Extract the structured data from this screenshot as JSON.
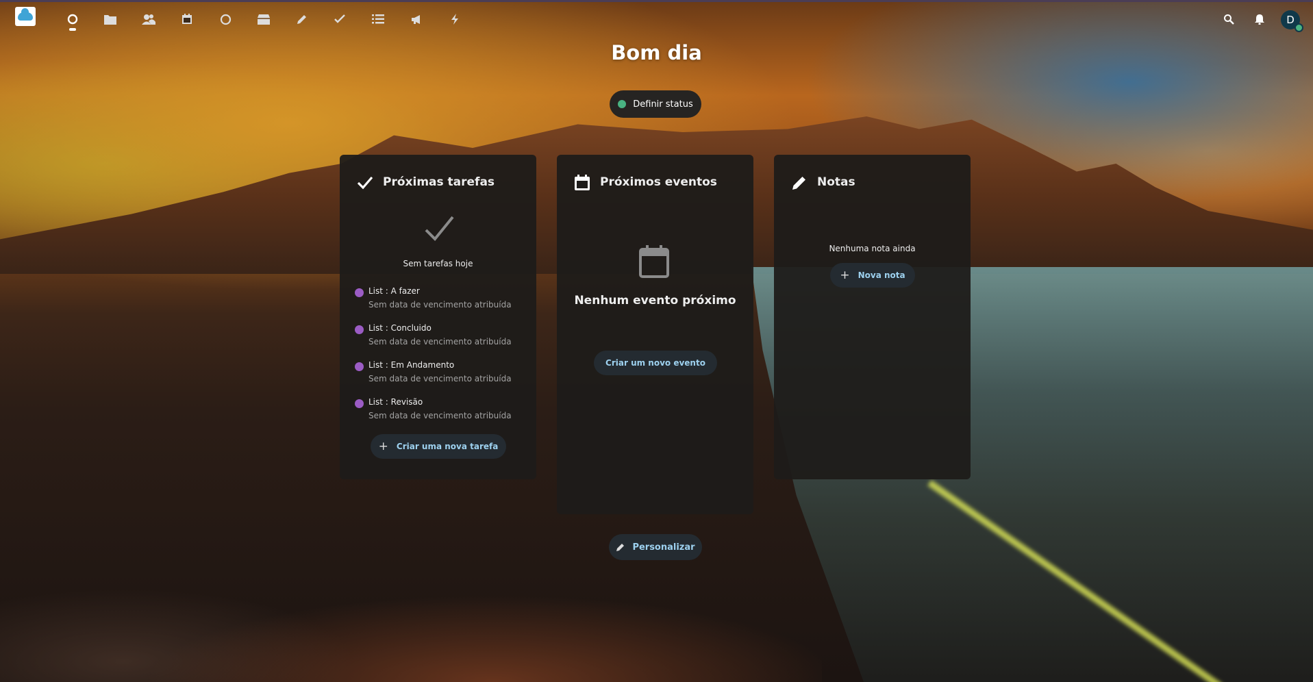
{
  "header": {
    "apps": [
      {
        "name": "dashboard-icon",
        "glyph": "◉"
      },
      {
        "name": "files-icon",
        "glyph": "▆"
      },
      {
        "name": "contacts-icon",
        "glyph": "👥"
      },
      {
        "name": "calendar-icon",
        "glyph": "▦"
      },
      {
        "name": "activity-icon",
        "glyph": "◯"
      },
      {
        "name": "photos-icon",
        "glyph": "▰"
      },
      {
        "name": "notes-icon",
        "glyph": "✎"
      },
      {
        "name": "tasks-icon",
        "glyph": "✔"
      },
      {
        "name": "deck-icon",
        "glyph": "☰"
      },
      {
        "name": "announcements-icon",
        "glyph": "📢"
      },
      {
        "name": "flow-icon",
        "glyph": "⚡"
      }
    ],
    "search_glyph": "⌕",
    "notifications_glyph": "🔔",
    "avatar_initial": "D"
  },
  "greeting": "Bom dia",
  "status_button": "Definir status",
  "widgets": {
    "tasks": {
      "title": "Próximas tarefas",
      "empty_text": "Sem tarefas hoje",
      "items": [
        {
          "name": "List : A fazer",
          "sub": "Sem data de vencimento atribuída"
        },
        {
          "name": "List : Concluido",
          "sub": "Sem data de vencimento atribuída"
        },
        {
          "name": "List : Em Andamento",
          "sub": "Sem data de vencimento atribuída"
        },
        {
          "name": "List : Revisão",
          "sub": "Sem data de vencimento atribuída"
        }
      ],
      "create_label": "Criar uma nova tarefa"
    },
    "events": {
      "title": "Próximos eventos",
      "empty_text": "Nenhum evento próximo",
      "create_label": "Criar um novo evento"
    },
    "notes": {
      "title": "Notas",
      "empty_text": "Nenhuma nota ainda",
      "create_label": "Nova nota"
    }
  },
  "customize_label": "Personalizar",
  "colors": {
    "accent_text": "#9dd1ef",
    "status_online": "#49b382",
    "task_dot": "#9b5cc4"
  }
}
